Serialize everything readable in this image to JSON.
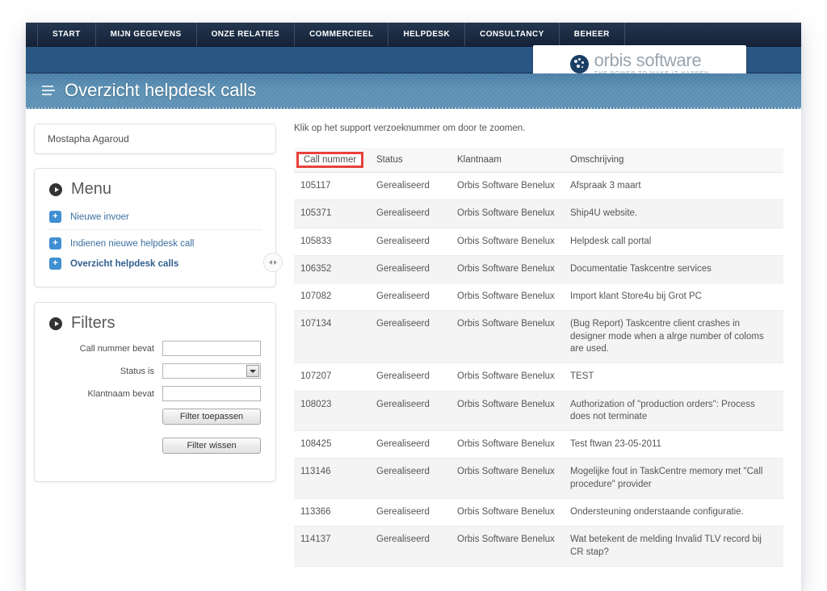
{
  "nav": {
    "items": [
      {
        "label": "START"
      },
      {
        "label": "MIJN GEGEVENS"
      },
      {
        "label": "ONZE RELATIES"
      },
      {
        "label": "COMMERCIEEL"
      },
      {
        "label": "HELPDESK"
      },
      {
        "label": "CONSULTANCY"
      },
      {
        "label": "BEHEER"
      }
    ]
  },
  "brand": {
    "name": "orbis",
    "name_secondary": " software",
    "tagline": "THE POWER TO MAKE IT HAPPEN",
    "logo_icon": "orbis-dots-icon",
    "color": "#1b3e66"
  },
  "header": {
    "title": "Overzicht helpdesk calls",
    "menu_icon": "hamburger-icon"
  },
  "sidebar": {
    "user": "Mostapha Agaroud",
    "menu": {
      "title": "Menu",
      "icon": "circle-arrow-icon",
      "items": [
        {
          "label": "Nieuwe invoer",
          "icon": "plus-icon",
          "active": false
        },
        {
          "label": "Indienen nieuwe helpdesk call",
          "icon": "plus-icon",
          "active": false
        },
        {
          "label": "Overzicht helpdesk calls",
          "icon": "plus-icon",
          "active": true
        }
      ]
    },
    "filters": {
      "title": "Filters",
      "icon": "circle-arrow-icon",
      "call_number_label": "Call nummer bevat",
      "call_number_value": "",
      "status_label": "Status is",
      "status_value": "",
      "klantnaam_label": "Klantnaam bevat",
      "klantnaam_value": "",
      "apply_button": "Filter toepassen",
      "clear_button": "Filter wissen"
    },
    "collapse_icon": "collapse-panel-icon"
  },
  "main": {
    "hint": "Klik op het support verzoeknummer om door te zoomen.",
    "columns": [
      "Call nummer",
      "Status",
      "Klantnaam",
      "Omschrijving"
    ],
    "highlighted_column": "Call nummer",
    "highlight_color": "#e8413a",
    "rows": [
      {
        "nummer": "105117",
        "status": "Gerealiseerd",
        "klantnaam": "Orbis Software Benelux",
        "omschrijving": "Afspraak 3 maart"
      },
      {
        "nummer": "105371",
        "status": "Gerealiseerd",
        "klantnaam": "Orbis Software Benelux",
        "omschrijving": "Ship4U website."
      },
      {
        "nummer": "105833",
        "status": "Gerealiseerd",
        "klantnaam": "Orbis Software Benelux",
        "omschrijving": "Helpdesk call portal"
      },
      {
        "nummer": "106352",
        "status": "Gerealiseerd",
        "klantnaam": "Orbis Software Benelux",
        "omschrijving": "Documentatie Taskcentre services"
      },
      {
        "nummer": "107082",
        "status": "Gerealiseerd",
        "klantnaam": "Orbis Software Benelux",
        "omschrijving": "Import klant Store4u bij Grot PC"
      },
      {
        "nummer": "107134",
        "status": "Gerealiseerd",
        "klantnaam": "Orbis Software Benelux",
        "omschrijving": "(Bug Report) Taskcentre client crashes in designer mode when a alrge number of coloms are used."
      },
      {
        "nummer": "107207",
        "status": "Gerealiseerd",
        "klantnaam": "Orbis Software Benelux",
        "omschrijving": "TEST"
      },
      {
        "nummer": "108023",
        "status": "Gerealiseerd",
        "klantnaam": "Orbis Software Benelux",
        "omschrijving": "Authorization of \"production orders\": Process does not terminate"
      },
      {
        "nummer": "108425",
        "status": "Gerealiseerd",
        "klantnaam": "Orbis Software Benelux",
        "omschrijving": "Test ftwan 23-05-2011"
      },
      {
        "nummer": "113146",
        "status": "Gerealiseerd",
        "klantnaam": "Orbis Software Benelux",
        "omschrijving": "Mogelijke fout in TaskCentre memory met \"Call procedure\" provider"
      },
      {
        "nummer": "113366",
        "status": "Gerealiseerd",
        "klantnaam": "Orbis Software Benelux",
        "omschrijving": "Ondersteuning onderstaande configuratie."
      },
      {
        "nummer": "114137",
        "status": "Gerealiseerd",
        "klantnaam": "Orbis Software Benelux",
        "omschrijving": "Wat betekent de melding Invalid TLV record bij CR stap?"
      }
    ]
  }
}
